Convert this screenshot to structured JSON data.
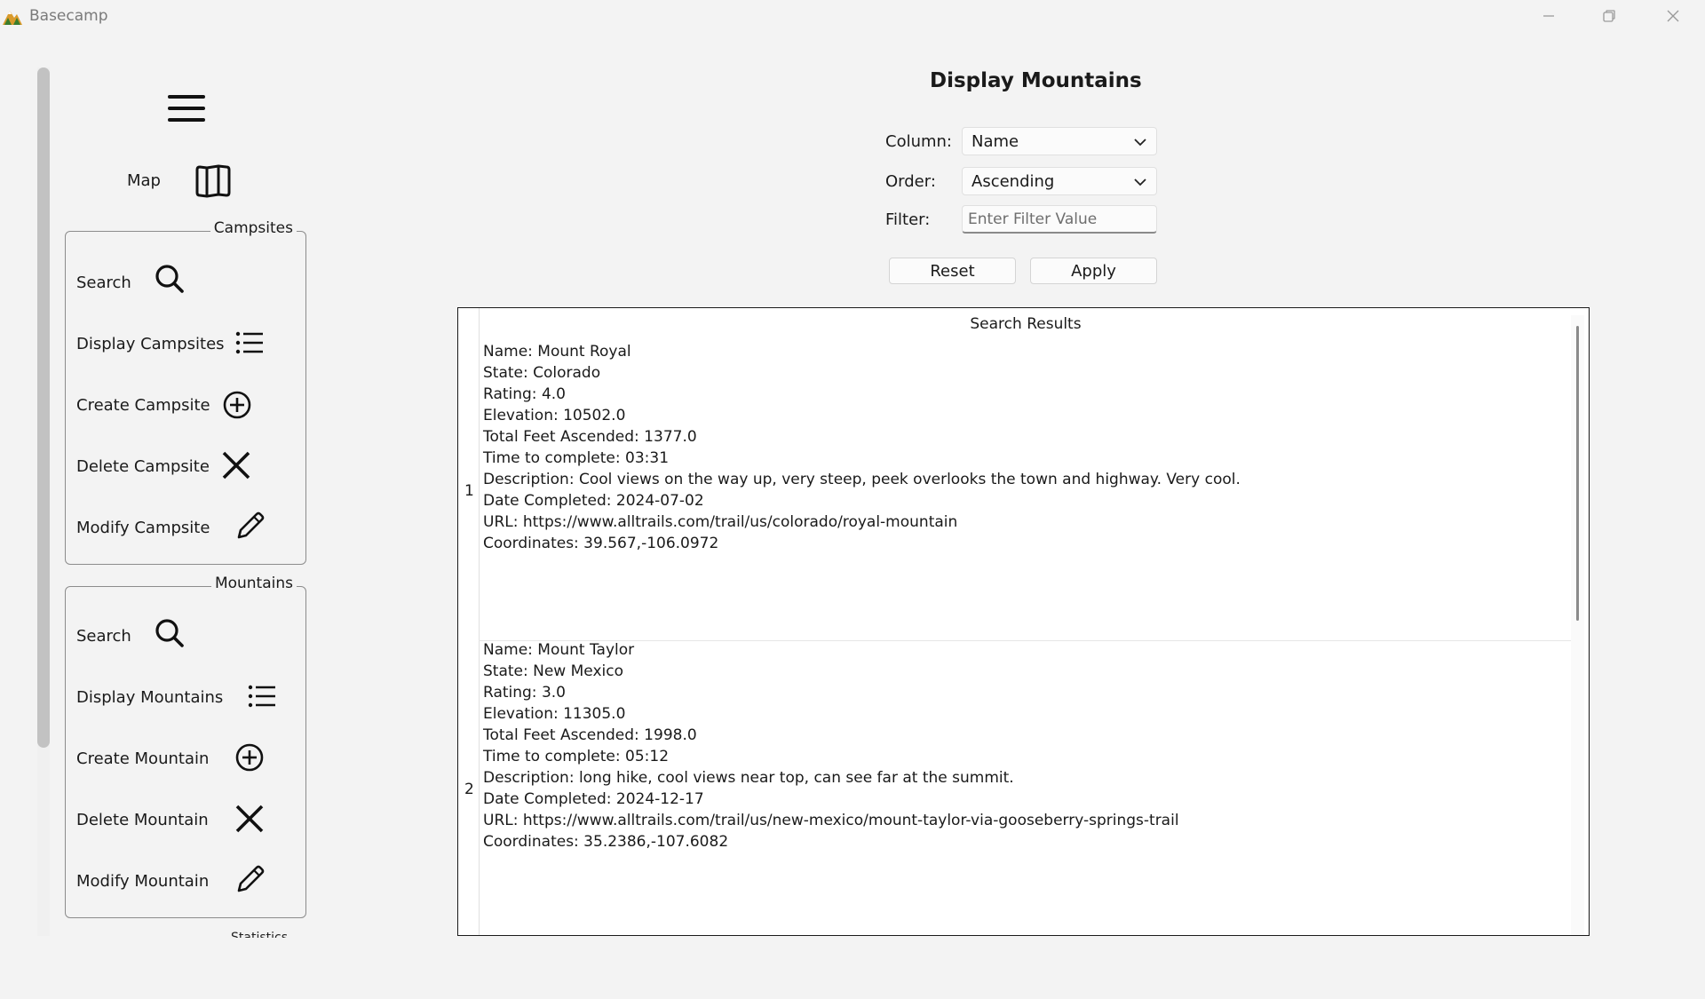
{
  "window": {
    "title": "Basecamp",
    "icons": {
      "app": "mountain-logo-icon",
      "minimize": "minimize-icon",
      "maximize": "restore-icon",
      "close": "close-icon"
    }
  },
  "sidebar": {
    "menu_icon": "hamburger-icon",
    "map_label": "Map",
    "map_icon": "map-icon",
    "campsites": {
      "title": "Campsites",
      "items": [
        {
          "label": "Search",
          "icon": "search-icon"
        },
        {
          "label": "Display Campsites",
          "icon": "list-icon"
        },
        {
          "label": "Create Campsite",
          "icon": "add-circle-icon"
        },
        {
          "label": "Delete Campsite",
          "icon": "x-icon"
        },
        {
          "label": "Modify Campsite",
          "icon": "pencil-icon"
        }
      ]
    },
    "mountains": {
      "title": "Mountains",
      "items": [
        {
          "label": "Search",
          "icon": "search-icon"
        },
        {
          "label": "Display Mountains",
          "icon": "list-icon"
        },
        {
          "label": "Create Mountain",
          "icon": "add-circle-icon"
        },
        {
          "label": "Delete Mountain",
          "icon": "x-icon"
        },
        {
          "label": "Modify Mountain",
          "icon": "pencil-icon"
        }
      ]
    },
    "next_group_title": "Statistics"
  },
  "main": {
    "title": "Display Mountains",
    "column": {
      "label": "Column:",
      "value": "Name"
    },
    "order": {
      "label": "Order:",
      "value": "Ascending"
    },
    "filter": {
      "label": "Filter:",
      "value": "",
      "placeholder": "Enter Filter Value"
    },
    "reset_label": "Reset",
    "apply_label": "Apply",
    "results": {
      "header": "Search Results",
      "rows": [
        {
          "index": "1",
          "lines": [
            "Name: Mount Royal",
            "State: Colorado",
            "Rating: 4.0",
            "Elevation: 10502.0",
            "Total Feet Ascended: 1377.0",
            "Time to complete: 03:31",
            "Description: Cool views on the way up, very steep, peek overlooks the town and highway. Very cool.",
            "Date Completed: 2024-07-02",
            "URL: https://www.alltrails.com/trail/us/colorado/royal-mountain",
            "Coordinates: 39.567,-106.0972"
          ]
        },
        {
          "index": "2",
          "lines": [
            "Name: Mount Taylor",
            "State: New Mexico",
            "Rating: 3.0",
            "Elevation: 11305.0",
            "Total Feet Ascended: 1998.0",
            "Time to complete: 05:12",
            "Description: long hike, cool views near top, can see far at the summit.",
            "Date Completed: 2024-12-17",
            "URL: https://www.alltrails.com/trail/us/new-mexico/mount-taylor-via-gooseberry-springs-trail",
            "Coordinates: 35.2386,-107.6082"
          ]
        }
      ]
    }
  }
}
